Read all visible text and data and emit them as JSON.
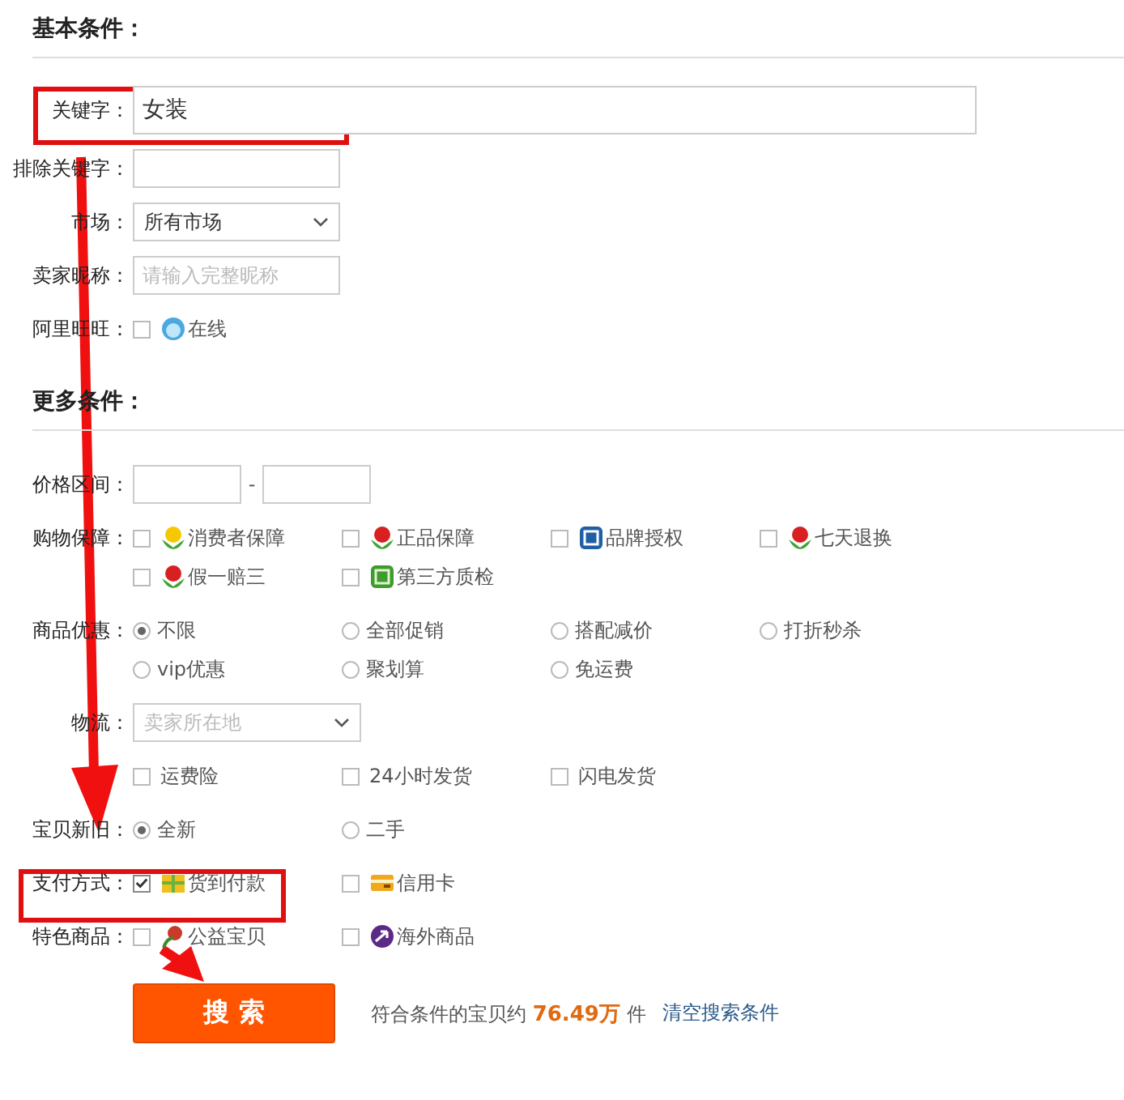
{
  "sections": [
    {
      "title": "基本条件：",
      "rows": [
        {
          "label": "关键字：",
          "kind": "input",
          "value": "女装"
        },
        {
          "label": "排除关键字：",
          "kind": "input"
        },
        {
          "label": "市场：",
          "kind": "select",
          "value": "所有市场"
        },
        {
          "label": "卖家昵称：",
          "kind": "input",
          "placeholder": "请输入完整昵称"
        },
        {
          "label": "阿里旺旺：",
          "kind": "checks",
          "options": [
            {
              "label": "在线",
              "checked": false
            }
          ]
        }
      ]
    },
    {
      "title": "更多条件：",
      "rows": [
        {
          "label": "价格区间：",
          "kind": "range",
          "separator": "-"
        },
        {
          "label": "购物保障：",
          "kind": "checks",
          "options": [
            {
              "label": "消费者保障",
              "checked": false
            },
            {
              "label": "正品保障",
              "checked": false
            },
            {
              "label": "品牌授权",
              "checked": false
            },
            {
              "label": "七天退换",
              "checked": false
            },
            {
              "label": "假一赔三",
              "checked": false
            },
            {
              "label": "第三方质检",
              "checked": false
            }
          ]
        },
        {
          "label": "商品优惠：",
          "kind": "radios",
          "options": [
            {
              "label": "不限",
              "selected": true
            },
            {
              "label": "全部促销",
              "selected": false
            },
            {
              "label": "搭配减价",
              "selected": false
            },
            {
              "label": "打折秒杀",
              "selected": false
            },
            {
              "label": "vip优惠",
              "selected": false
            },
            {
              "label": "聚划算",
              "selected": false
            },
            {
              "label": "免运费",
              "selected": false
            }
          ]
        },
        {
          "label": "物流：",
          "kind": "select",
          "placeholder": "卖家所在地"
        },
        {
          "kind": "checks",
          "options": [
            {
              "label": "运费险",
              "checked": false
            },
            {
              "label": "24小时发货",
              "checked": false
            },
            {
              "label": "闪电发货",
              "checked": false
            }
          ]
        },
        {
          "label": "宝贝新旧：",
          "kind": "radios",
          "options": [
            {
              "label": "全新",
              "selected": true
            },
            {
              "label": "二手",
              "selected": false
            }
          ]
        },
        {
          "label": "支付方式：",
          "kind": "checks",
          "options": [
            {
              "label": "货到付款",
              "checked": true
            },
            {
              "label": "信用卡",
              "checked": false
            }
          ]
        },
        {
          "label": "特色商品：",
          "kind": "checks",
          "options": [
            {
              "label": "公益宝贝",
              "checked": false
            },
            {
              "label": "海外商品",
              "checked": false
            }
          ]
        }
      ]
    }
  ],
  "footer": {
    "button": "搜 索",
    "result": "符合条件的宝贝约 **76.49万** 件",
    "clear_link": "清空搜索条件"
  }
}
